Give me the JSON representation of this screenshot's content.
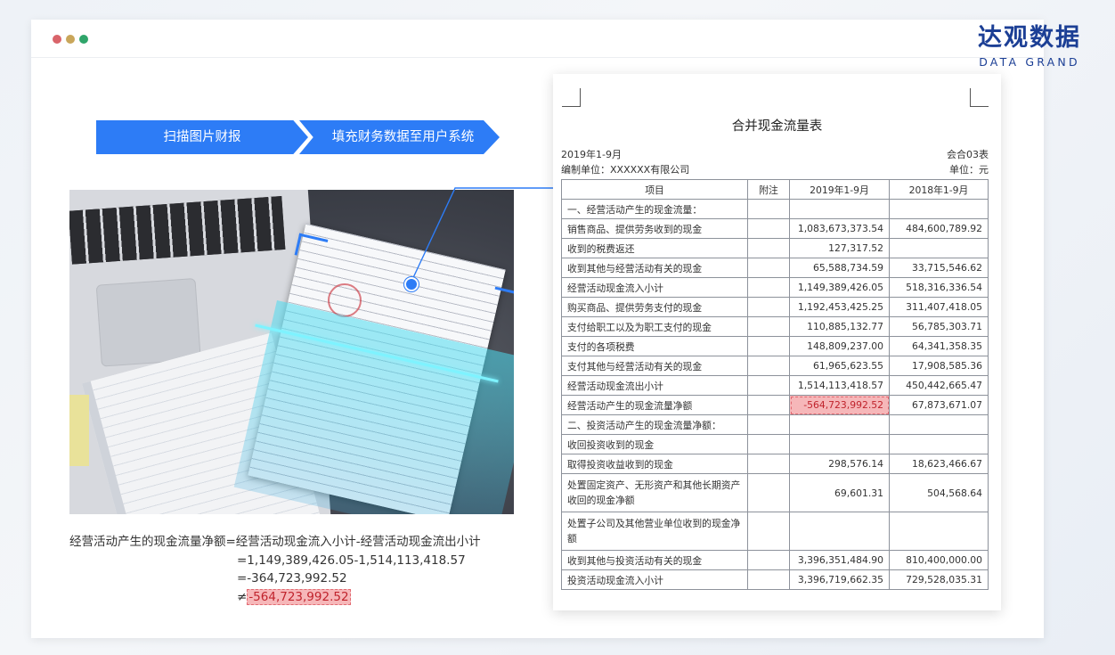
{
  "brand": {
    "name_cn": "达观数据",
    "name_en": "DATA GRAND",
    "color": "#1c3f95"
  },
  "steps": [
    "扫描图片财报",
    "填充财务数据至用户系统"
  ],
  "formula": {
    "line1": "经营活动产生的现金流量净额=经营活动现金流入小计-经营活动现金流出小计",
    "line2": "=1,149,389,426.05-1,514,113,418.57",
    "line3": "=-364,723,992.52",
    "ne": "≠",
    "wrong_value": "-564,723,992.52"
  },
  "statement": {
    "title": "合并现金流量表",
    "period": "2019年1-9月",
    "form_code": "会合03表",
    "unit_label": "编制单位：XXXXXX有限公司",
    "currency": "单位：元",
    "columns": [
      "项目",
      "附注",
      "2019年1-9月",
      "2018年1-9月"
    ],
    "rows": [
      {
        "item": "一、经营活动产生的现金流量：",
        "note": "",
        "y2019": "",
        "y2018": ""
      },
      {
        "item": "销售商品、提供劳务收到的现金",
        "note": "",
        "y2019": "1,083,673,373.54",
        "y2018": "484,600,789.92"
      },
      {
        "item": "收到的税费返还",
        "note": "",
        "y2019": "127,317.52",
        "y2018": ""
      },
      {
        "item": "收到其他与经营活动有关的现金",
        "note": "",
        "y2019": "65,588,734.59",
        "y2018": "33,715,546.62"
      },
      {
        "item": "经营活动现金流入小计",
        "note": "",
        "y2019": "1,149,389,426.05",
        "y2018": "518,316,336.54"
      },
      {
        "item": "购买商品、提供劳务支付的现金",
        "note": "",
        "y2019": "1,192,453,425.25",
        "y2018": "311,407,418.05"
      },
      {
        "item": "支付给职工以及为职工支付的现金",
        "note": "",
        "y2019": "110,885,132.77",
        "y2018": "56,785,303.71"
      },
      {
        "item": "支付的各项税费",
        "note": "",
        "y2019": "148,809,237.00",
        "y2018": "64,341,358.35"
      },
      {
        "item": "支付其他与经营活动有关的现金",
        "note": "",
        "y2019": "61,965,623.55",
        "y2018": "17,908,585.36"
      },
      {
        "item": "经营活动现金流出小计",
        "note": "",
        "y2019": "1,514,113,418.57",
        "y2018": "450,442,665.47"
      },
      {
        "item": "经营活动产生的现金流量净额",
        "note": "",
        "y2019": "-564,723,992.52",
        "y2018": "67,873,671.07",
        "flag": true
      },
      {
        "item": "二、投资活动产生的现金流量净额：",
        "note": "",
        "y2019": "",
        "y2018": ""
      },
      {
        "item": "收回投资收到的现金",
        "note": "",
        "y2019": "",
        "y2018": ""
      },
      {
        "item": "取得投资收益收到的现金",
        "note": "",
        "y2019": "298,576.14",
        "y2018": "18,623,466.67"
      },
      {
        "item": "处置固定资产、无形资产和其他长期资产收回的现金净额",
        "note": "",
        "y2019": "69,601.31",
        "y2018": "504,568.64",
        "tall": true
      },
      {
        "item": "处置子公司及其他营业单位收到的现金净额",
        "note": "",
        "y2019": "",
        "y2018": "",
        "tall": true
      },
      {
        "item": "收到其他与投资活动有关的现金",
        "note": "",
        "y2019": "3,396,351,484.90",
        "y2018": "810,400,000.00"
      },
      {
        "item": "投资活动现金流入小计",
        "note": "",
        "y2019": "3,396,719,662.35",
        "y2018": "729,528,035.31"
      }
    ]
  },
  "colors": {
    "accent": "#2d7cf6",
    "highlight_bg": "#f6b7b9",
    "highlight_text": "#c0232c"
  }
}
